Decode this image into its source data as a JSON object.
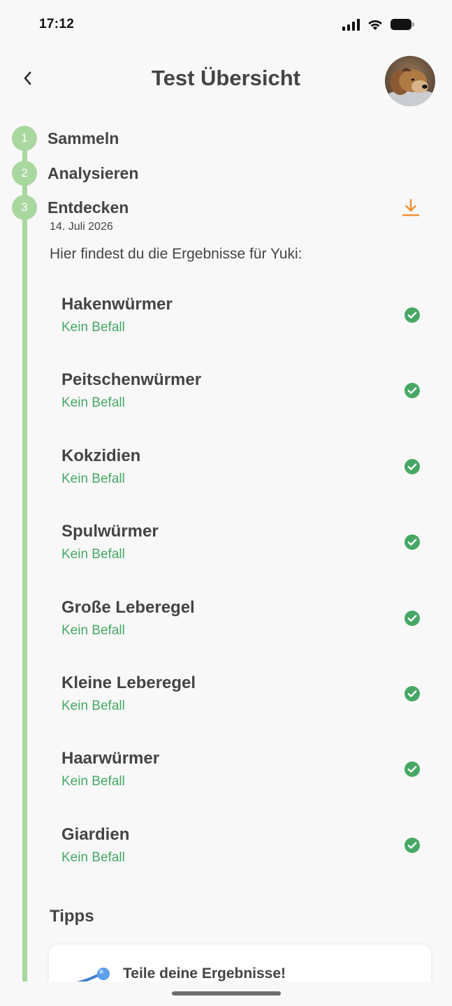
{
  "status_bar": {
    "time": "17:12"
  },
  "header": {
    "title": "Test Übersicht",
    "back_icon": "chevron-left-icon",
    "avatar_alt": "dog-photo"
  },
  "steps": [
    {
      "number": "1",
      "label": "Sammeln"
    },
    {
      "number": "2",
      "label": "Analysieren"
    },
    {
      "number": "3",
      "label": "Entdecken"
    }
  ],
  "discover": {
    "date": "14. Juli 2026",
    "intro": "Hier findest du die Ergebnisse für Yuki:",
    "download_icon": "download-icon"
  },
  "results": [
    {
      "name": "Hakenwürmer",
      "status": "Kein Befall"
    },
    {
      "name": "Peitschenwürmer",
      "status": "Kein Befall"
    },
    {
      "name": "Kokzidien",
      "status": "Kein Befall"
    },
    {
      "name": "Spulwürmer",
      "status": "Kein Befall"
    },
    {
      "name": "Große Leberegel",
      "status": "Kein Befall"
    },
    {
      "name": "Kleine Leberegel",
      "status": "Kein Befall"
    },
    {
      "name": "Haarwürmer",
      "status": "Kein Befall"
    },
    {
      "name": "Giardien",
      "status": "Kein Befall"
    }
  ],
  "tips": {
    "heading": "Tipps",
    "card_title": "Teile deine Ergebnisse!"
  },
  "colors": {
    "timeline": "#a9d7a0",
    "success": "#46a864",
    "download": "#f0903a"
  }
}
